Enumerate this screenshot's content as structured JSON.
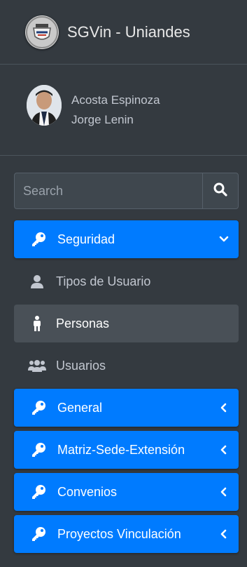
{
  "brand": {
    "title": "SGVin - Uniandes",
    "logo_icon": "university-seal-icon"
  },
  "user": {
    "name_line1": "Acosta Espinoza",
    "name_line2": "Jorge Lenin"
  },
  "search": {
    "placeholder": "Search",
    "icon": "search-icon"
  },
  "colors": {
    "accent": "#007bff",
    "sidebar_bg": "#343a40",
    "active_sub_bg": "#495057",
    "text": "#c2c7d0"
  },
  "menu": {
    "seguridad": {
      "label": "Seguridad",
      "icon": "key-icon",
      "expanded": true
    },
    "sub": [
      {
        "label": "Tipos de Usuario",
        "icon": "user-icon"
      },
      {
        "label": "Personas",
        "icon": "person-standing-icon",
        "active": true
      },
      {
        "label": "Usuarios",
        "icon": "users-icon"
      }
    ],
    "general": {
      "label": "General",
      "icon": "key-icon"
    },
    "matriz": {
      "label": "Matriz-Sede-Extensión",
      "icon": "key-icon"
    },
    "convenios": {
      "label": "Convenios",
      "icon": "key-icon"
    },
    "proyectos": {
      "label": "Proyectos Vinculación",
      "icon": "key-icon"
    }
  }
}
